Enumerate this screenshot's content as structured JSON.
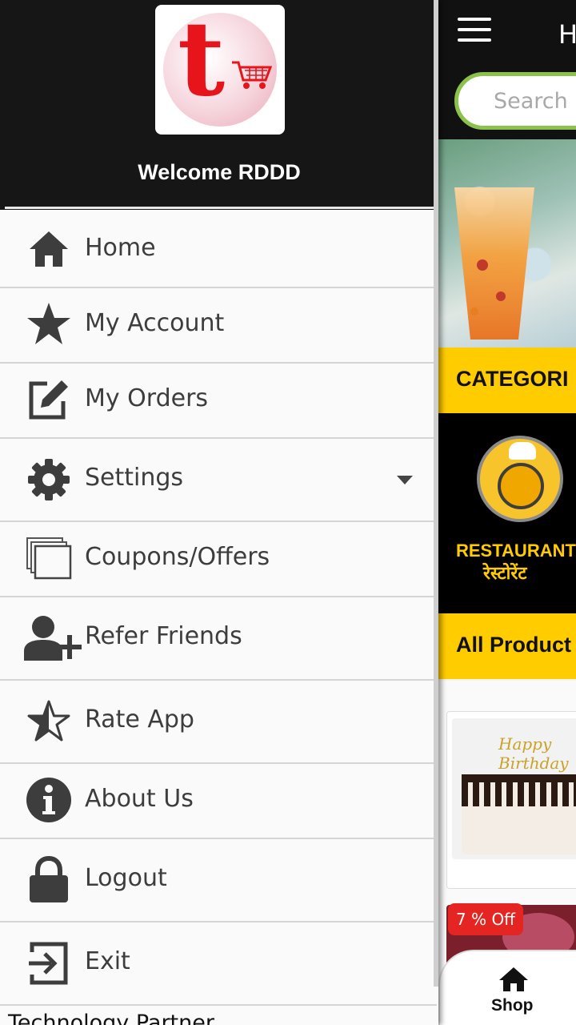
{
  "app": {
    "title_fragment": "H",
    "search_placeholder": "Search p",
    "categories_heading": "CATEGORI",
    "category": {
      "name": "RESTAURANT",
      "name_hindi": "रेस्टोरेंट"
    },
    "all_products_heading": "All Product",
    "cake_topper": "Happy Birthday",
    "discount_badge": "7 % Off",
    "bottom_nav": {
      "shop_label": "Shop",
      "icon": "home-icon"
    }
  },
  "drawer": {
    "welcome": "Welcome RDDD",
    "logo_icon": "t-cart-logo",
    "menu": [
      {
        "label": "Home",
        "icon": "home-icon"
      },
      {
        "label": "My Account",
        "icon": "star-icon"
      },
      {
        "label": "My Orders",
        "icon": "edit-icon"
      },
      {
        "label": "Settings",
        "icon": "gear-icon",
        "has_dropdown": true
      },
      {
        "label": "Coupons/Offers",
        "icon": "copy-icon"
      },
      {
        "label": "Refer Friends",
        "icon": "add-user-icon"
      },
      {
        "label": "Rate App",
        "icon": "star-half-icon"
      },
      {
        "label": "About Us",
        "icon": "info-icon"
      },
      {
        "label": "Logout",
        "icon": "lock-icon"
      },
      {
        "label": "Exit",
        "icon": "exit-icon"
      }
    ],
    "footer_text": "Technology Partner"
  },
  "colors": {
    "header_bg": "#161616",
    "accent_yellow": "#ffcc00",
    "search_border": "#8bc34a",
    "badge_red": "#e52521",
    "icon_gray": "#3d3d3d"
  }
}
